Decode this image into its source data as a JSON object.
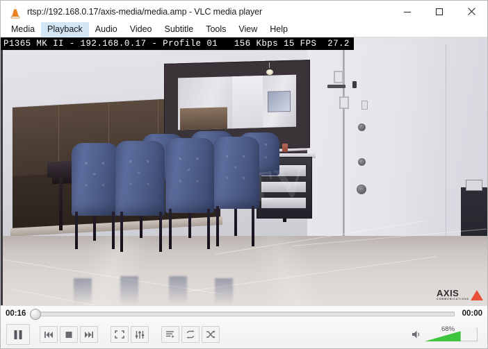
{
  "window": {
    "title": "rtsp://192.168.0.17/axis-media/media.amp - VLC media player",
    "app_icon": "vlc-cone-icon",
    "controls": {
      "minimize": "minimize-icon",
      "maximize": "maximize-icon",
      "close": "close-icon"
    }
  },
  "menubar": {
    "items": [
      {
        "label": "Media",
        "active": false
      },
      {
        "label": "Playback",
        "active": true
      },
      {
        "label": "Audio",
        "active": false
      },
      {
        "label": "Video",
        "active": false
      },
      {
        "label": "Subtitle",
        "active": false
      },
      {
        "label": "Tools",
        "active": false
      },
      {
        "label": "View",
        "active": false
      },
      {
        "label": "Help",
        "active": false
      }
    ]
  },
  "video": {
    "osd_text": "P1365 MK II - 192.168.0.17 - Profile 01   156 Kbps 15 FPS  27.2",
    "osd_fields": {
      "camera_model": "P1365 MK II",
      "ip_address": "192.168.0.17",
      "profile": "Profile 01",
      "bitrate": "156 Kbps",
      "framerate": "15 FPS",
      "value": "27.2"
    },
    "watermark": "CCTV",
    "brand_logo": {
      "word": "AXIS",
      "subtitle": "COMMUNICATIONS",
      "triangle_color": "#e8442a"
    },
    "scene_description": "dining room with blue tufted chairs"
  },
  "controls": {
    "elapsed_time": "00:16",
    "total_time": "00:00",
    "seek_position_percent": 0,
    "buttons": [
      {
        "name": "play-pause-button",
        "icon": "pause-icon"
      },
      {
        "name": "previous-button",
        "icon": "previous-icon"
      },
      {
        "name": "stop-button",
        "icon": "stop-icon"
      },
      {
        "name": "next-button",
        "icon": "next-icon"
      },
      {
        "name": "fullscreen-button",
        "icon": "fullscreen-icon"
      },
      {
        "name": "extended-settings-button",
        "icon": "equalizer-icon"
      },
      {
        "name": "playlist-button",
        "icon": "playlist-icon"
      },
      {
        "name": "loop-button",
        "icon": "loop-icon"
      },
      {
        "name": "shuffle-button",
        "icon": "shuffle-icon"
      }
    ],
    "volume": {
      "label": "68%",
      "percent": 68,
      "icon": "speaker-icon",
      "fill_color": "#3ec43e"
    }
  },
  "colors": {
    "menu_highlight": "#d3e6f5",
    "osd_background": "#000000",
    "osd_text": "#ffffff",
    "volume_green": "#3ec43e",
    "axis_red": "#e8442a"
  }
}
